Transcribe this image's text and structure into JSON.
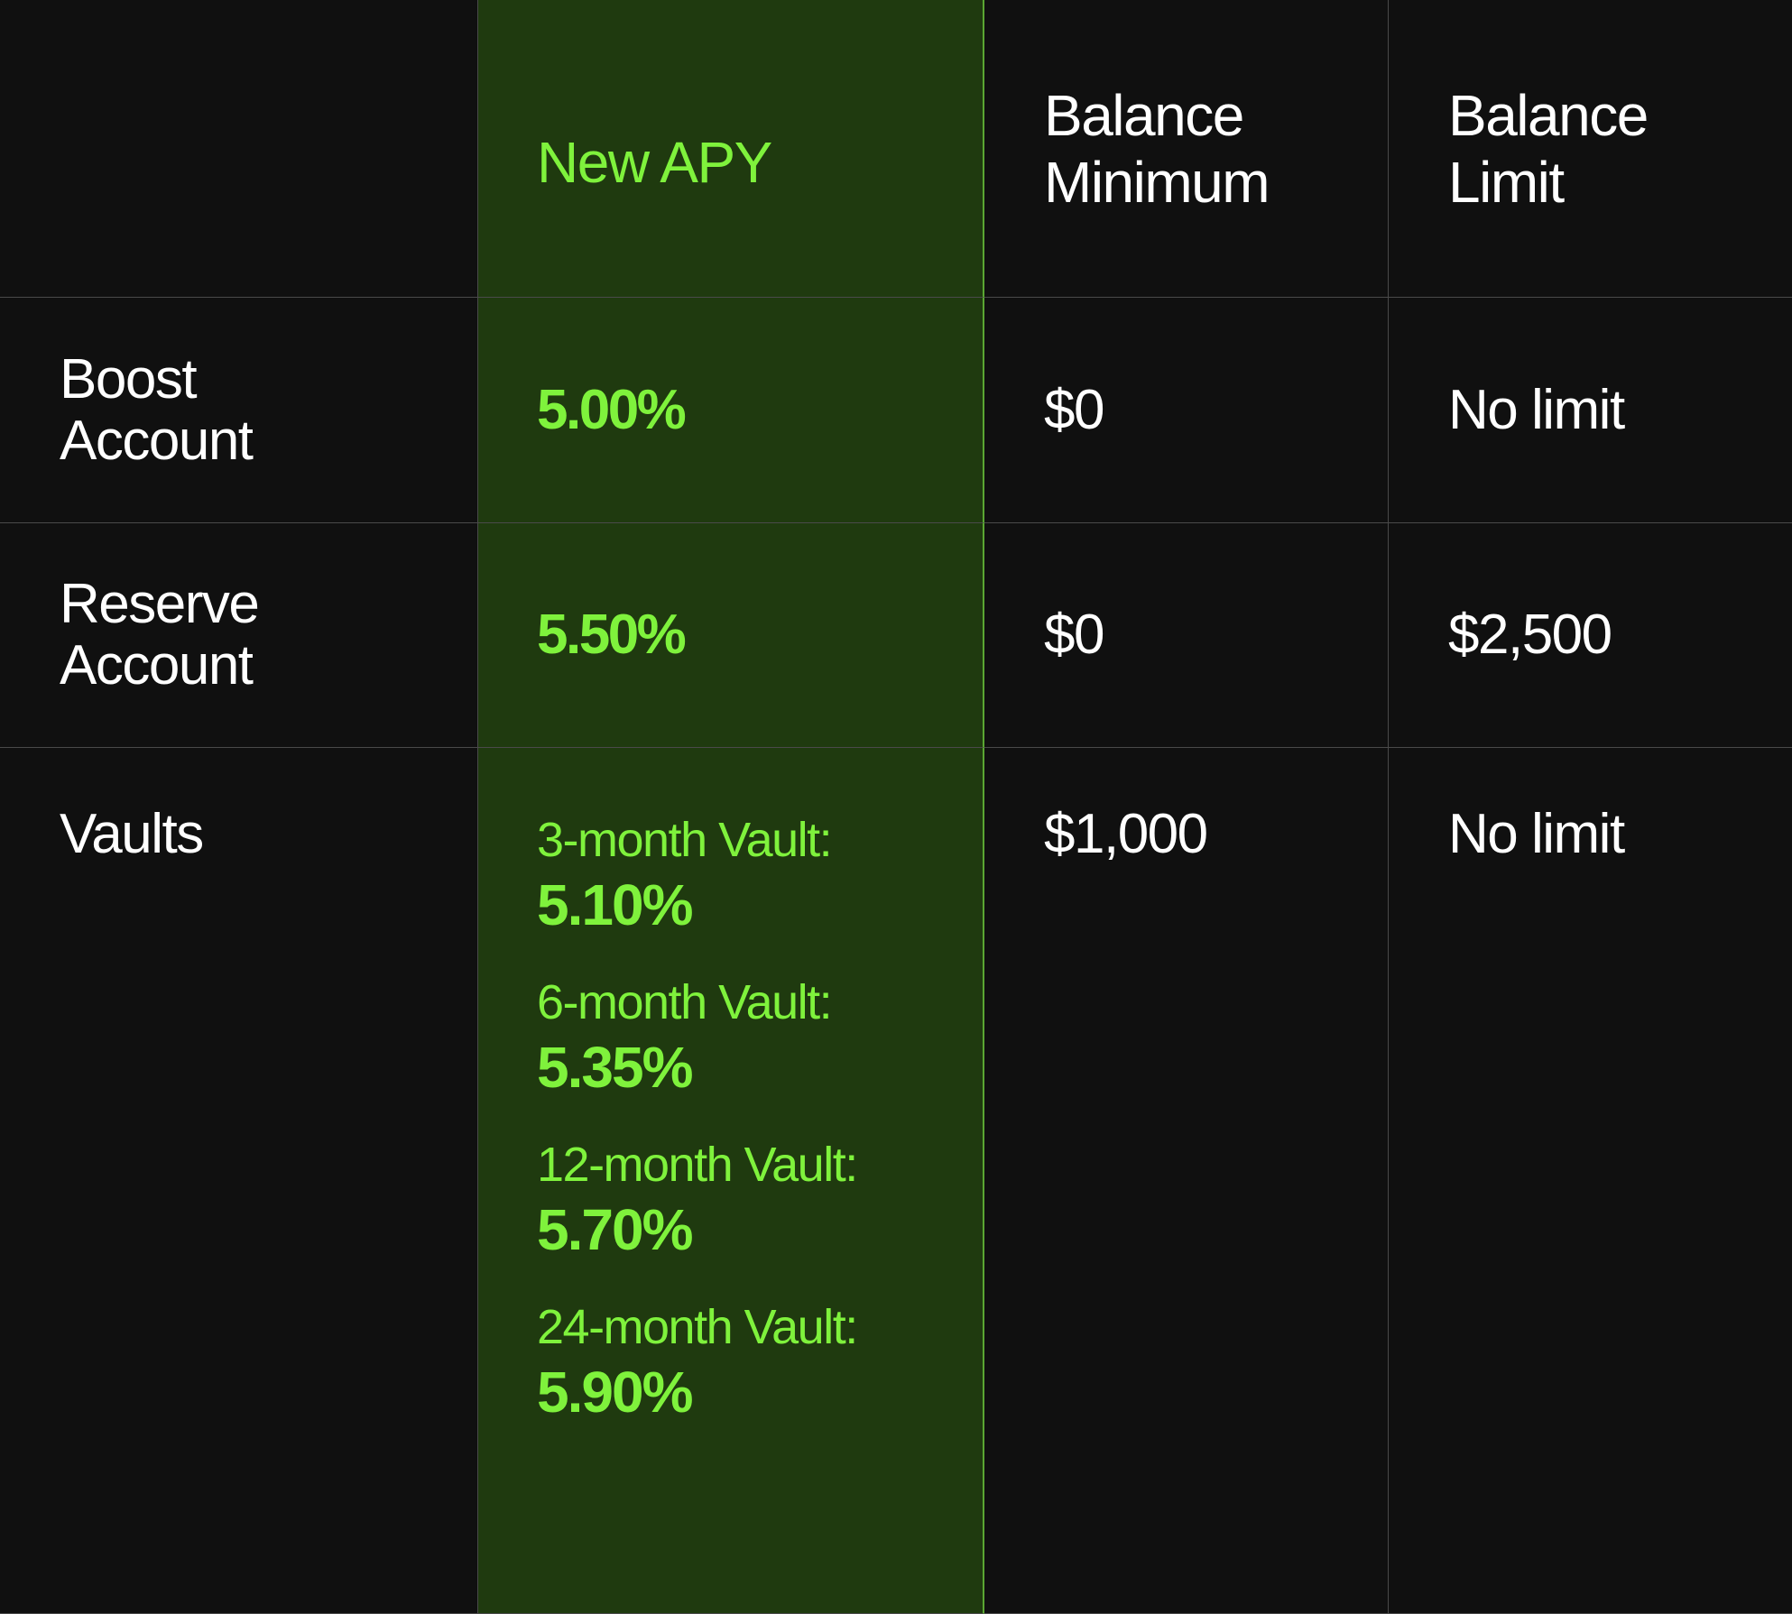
{
  "header": {
    "col_account": "",
    "col_apy": "New APY",
    "col_minimum": "Balance Minimum",
    "col_minimum_lines": [
      "Balance",
      "Minimum"
    ],
    "col_limit": "Balance Limit",
    "col_limit_lines": [
      "Balance",
      "Limit"
    ]
  },
  "rows": [
    {
      "account_lines": [
        "Boost",
        "Account"
      ],
      "apy": "5.00%",
      "minimum": "$0",
      "limit": "No limit"
    },
    {
      "account_lines": [
        "Reserve",
        "Account"
      ],
      "apy": "5.50%",
      "minimum": "$0",
      "limit": "$2,500"
    },
    {
      "account": "Vaults",
      "vaults": [
        {
          "label": "3-month Vault:",
          "rate": "5.10%"
        },
        {
          "label": "6-month Vault:",
          "rate": "5.35%"
        },
        {
          "label": "12-month Vault:",
          "rate": "5.70%"
        },
        {
          "label": "24-month Vault:",
          "rate": "5.90%"
        }
      ],
      "minimum": "$1,000",
      "limit": "No limit"
    }
  ],
  "colors": {
    "background": "#101010",
    "apy_column_bg": "#1f3a0f",
    "apy_text": "#7ff23c",
    "apy_border": "#5aa632",
    "text": "#ffffff",
    "grid_line": "#4a4a4a"
  }
}
